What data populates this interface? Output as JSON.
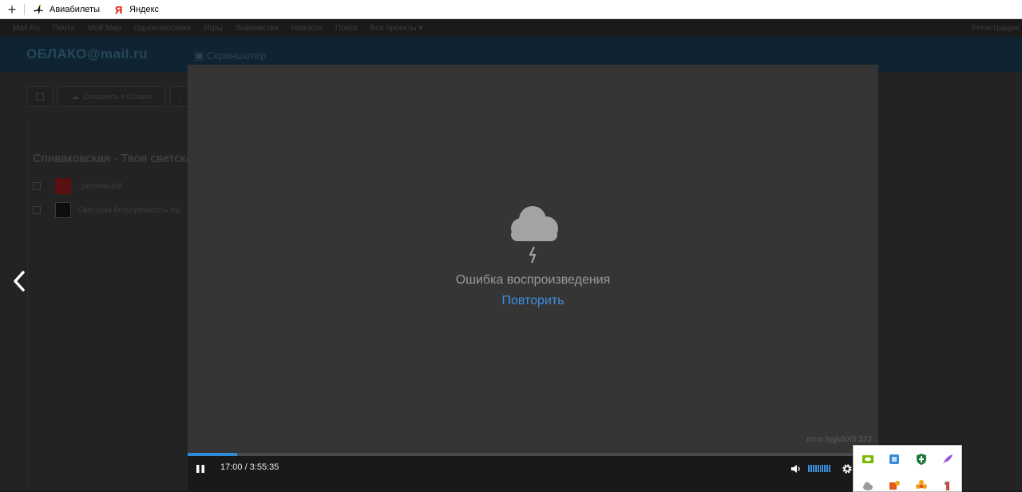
{
  "bookmarks": {
    "new_tab": "+",
    "items": [
      {
        "label": "Авиабилеты",
        "icon": "plane-icon"
      },
      {
        "label": "Яндекс",
        "icon": "yandex-icon"
      }
    ]
  },
  "background": {
    "nav": [
      "Mail.Ru",
      "Почта",
      "Мой Мир",
      "Одноклассники",
      "Игры",
      "Знакомства",
      "Новости",
      "Поиск",
      "Все проекты ▾"
    ],
    "register": "Регистрация",
    "logo": "ОБЛАКО@mail.ru",
    "screenshoter": "Скриншотер",
    "save_to_cloud": "Сохранить в Облако",
    "folder_title": "Спиваковская - Твоя светска",
    "files": [
      {
        "name": "_preview.pdf",
        "icon": "pdf-icon"
      },
      {
        "name": "Светская безупречность.mp",
        "icon": "video-file-icon"
      }
    ]
  },
  "player": {
    "error_message": "Ошибка воспроизведения",
    "retry_label": "Повторить",
    "error_code": "error:lqgk6iX0 323",
    "time": "17:00 / 3:55:35",
    "progress_fraction": 0.0722,
    "volume_bars": 10,
    "colors": {
      "accent": "#3d90e3",
      "background": "#353535",
      "controls": "#191919"
    }
  },
  "tray": {
    "icons": [
      "nvidia-icon",
      "network-icon",
      "shield-icon",
      "feather-icon",
      "cloud-icon",
      "puzzle-icon",
      "flower-icon",
      "usb-icon"
    ]
  }
}
